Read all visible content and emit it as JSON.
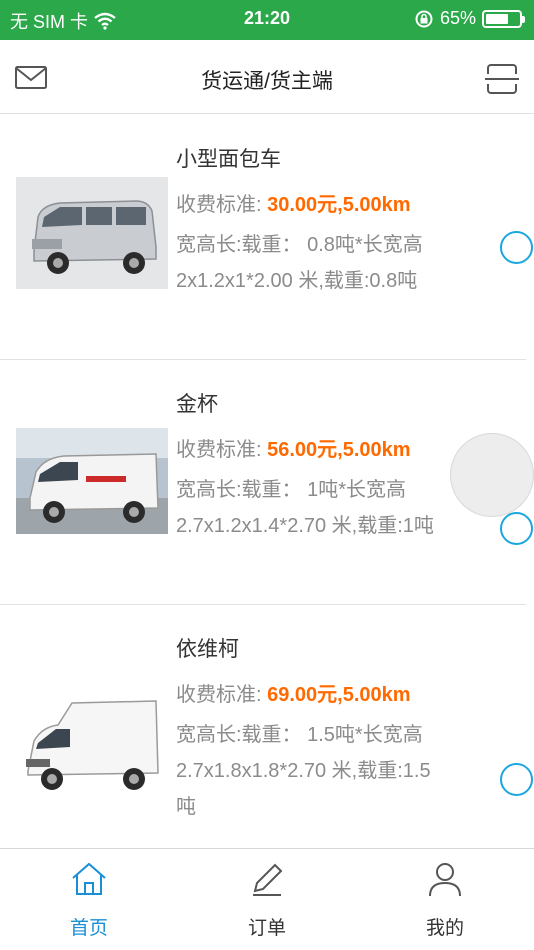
{
  "status_bar": {
    "carrier": "无 SIM 卡",
    "time": "21:20",
    "battery": "65%"
  },
  "header": {
    "title": "货运通/货主端",
    "mail_icon": "mail-icon",
    "scan_icon": "scan-icon"
  },
  "vehicles": [
    {
      "name": "小型面包车",
      "price_label": "收费标准:",
      "price": "30.00元,5.00km",
      "line1": "宽高长:载重： 0.8吨*长宽高",
      "line2": "2x1.2x1*2.00 米,载重:0.8吨",
      "line3": "",
      "selected": false
    },
    {
      "name": "金杯",
      "price_label": "收费标准:",
      "price": "56.00元,5.00km",
      "line1": "宽高长:载重： 1吨*长宽高",
      "line2": "2.7x1.2x1.4*2.70 米,载重:1吨",
      "line3": "",
      "selected": false
    },
    {
      "name": "依维柯",
      "price_label": "收费标准:",
      "price": "69.00元,5.00km",
      "line1": "宽高长:载重： 1.5吨*长宽高",
      "line2": "2.7x1.8x1.8*2.70 米,载重:1.5",
      "line3": "吨",
      "selected": false
    }
  ],
  "tabs": [
    {
      "label": "首页",
      "icon": "home-icon",
      "active": true
    },
    {
      "label": "订单",
      "icon": "pencil-icon",
      "active": false
    },
    {
      "label": "我的",
      "icon": "user-icon",
      "active": false
    }
  ],
  "colors": {
    "status_bar": "#2aa84a",
    "price": "#ff6a00",
    "accent": "#1a8fd6",
    "radio": "#1aa7e0"
  }
}
